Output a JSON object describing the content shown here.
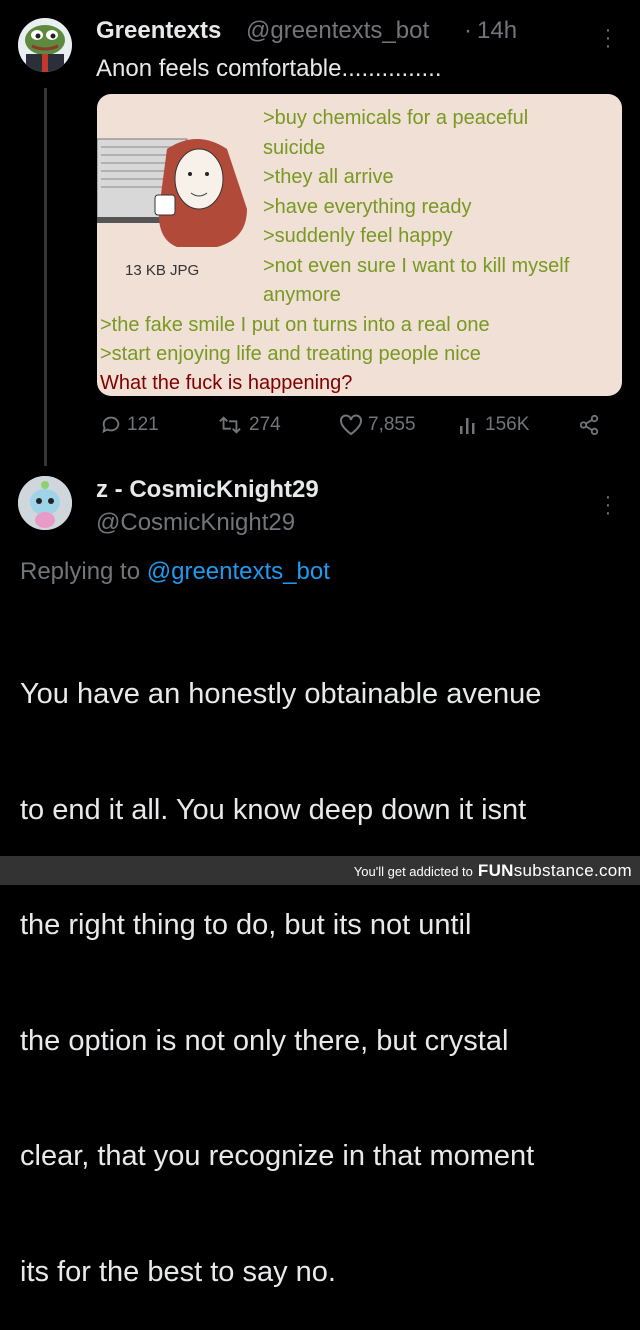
{
  "tweet": {
    "display_name": "Greentexts",
    "handle": "@greentexts_bot",
    "separator": "·",
    "time": "14h",
    "text": "Anon feels comfortable...............",
    "image": {
      "file_info": "13 KB JPG",
      "lines_right": [
        ">buy chemicals for a peaceful",
        "suicide",
        ">they all arrive",
        ">have everything ready",
        ">suddenly feel happy",
        ">not even sure I want to kill myself",
        "anymore"
      ],
      "lines_full": [
        ">the fake smile I put on turns into a real one",
        ">start enjoying life and treating people nice"
      ],
      "last_line": "What the fuck is happening?"
    },
    "actions": {
      "replies": "121",
      "retweets": "274",
      "likes": "7,855",
      "views": "156K"
    }
  },
  "reply": {
    "display_name": "z - CosmicKnight29",
    "handle": "@CosmicKnight29",
    "replying_prefix": "Replying to",
    "replying_to": "@greentexts_bot",
    "body_lines": [
      "You have an honestly obtainable avenue",
      "to end it all. You know deep down it isnt",
      "the right thing to do, but its not until",
      "the option is not only there, but crystal",
      "clear, that you recognize in that moment",
      "its for the best to say no."
    ]
  },
  "footer": {
    "text": "You'll get addicted to",
    "brand_fun": "FUN",
    "brand_sub": "substance",
    "brand_tld": ".com"
  },
  "colors": {
    "background": "#000000",
    "greentext": "#789922",
    "redtext": "#800000",
    "card_bg": "#f0e0d6",
    "link": "#1d9bf0",
    "muted": "#71767b"
  }
}
